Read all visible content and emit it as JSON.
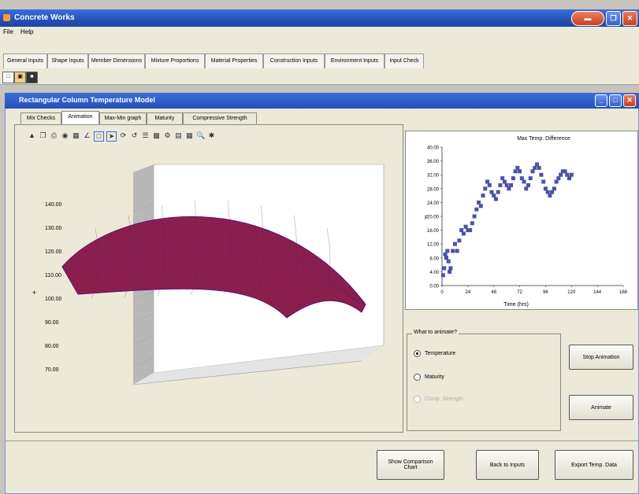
{
  "app": {
    "title": "Concrete Works"
  },
  "menu": {
    "file": "File",
    "help": "Help"
  },
  "top_tabs": [
    "General Inputs",
    "Shape Inputs",
    "Member Dimensions",
    "Mixture Proportions",
    "Material Properties",
    "Construction Inputs",
    "Environment Inputs",
    "Input Check"
  ],
  "inner": {
    "title": "Rectangular Column Temperature Model"
  },
  "sub_tabs": [
    "Mix Checks",
    "Animation",
    "Max-Min graph",
    "Maturity",
    "Compressive Strength"
  ],
  "surface": {
    "z_ticks": [
      "140.00",
      "130.00",
      "120.00",
      "110.00",
      "100.00",
      "90.00",
      "80.00",
      "70.00"
    ],
    "colors": {
      "surface": "#8a1f4e",
      "edge": "#5a1070",
      "wall": "#b8b8b8"
    }
  },
  "chart_data": {
    "type": "scatter",
    "title": "Max Temp. Difference",
    "xlabel": "Time (hrs)",
    "ylabel": "F",
    "xlim": [
      0,
      168
    ],
    "ylim": [
      0,
      40
    ],
    "x_ticks": [
      "0",
      "24",
      "48",
      "72",
      "96",
      "120",
      "144",
      "168"
    ],
    "y_ticks": [
      "40.00",
      "36.00",
      "32.00",
      "28.00",
      "24.00",
      "20.00",
      "16.00",
      "12.00",
      "8.00",
      "4.00",
      "0.00"
    ],
    "series": [
      {
        "color": "#4a52a8",
        "x": [
          1,
          2,
          3,
          4,
          5,
          6,
          7,
          8,
          10,
          12,
          14,
          16,
          18,
          20,
          22,
          24,
          26,
          28,
          30,
          32,
          34,
          36,
          38,
          40,
          42,
          44,
          46,
          48,
          50,
          52,
          54,
          56,
          58,
          60,
          62,
          64,
          66,
          68,
          70,
          72,
          74,
          76,
          78,
          80,
          82,
          84,
          86,
          88,
          90,
          92,
          94,
          96,
          98,
          100,
          102,
          104,
          106,
          108,
          110,
          112,
          114,
          116,
          118,
          120
        ],
        "y": [
          3,
          5,
          9,
          8,
          10,
          7,
          4,
          5,
          10,
          12,
          10,
          13,
          16,
          15,
          17,
          16,
          16,
          18,
          20,
          22,
          24,
          23,
          26,
          28,
          30,
          29,
          27,
          26,
          25,
          27,
          29,
          31,
          30,
          29,
          28,
          29,
          31,
          33,
          34,
          33,
          31,
          30,
          28,
          29,
          31,
          33,
          34,
          35,
          34,
          32,
          30,
          28,
          27,
          26,
          27,
          28,
          30,
          31,
          32,
          33,
          33,
          32,
          31,
          32
        ]
      }
    ]
  },
  "animate_group": {
    "legend": "What to animate?",
    "options": [
      "Temperature",
      "Maturity",
      "Comp. Strength"
    ],
    "selected": "Temperature"
  },
  "buttons": {
    "stop_animation": "Stop Animation",
    "animate": "Animate",
    "show_comparison": "Show Comparison Chart",
    "back_to_inputs": "Back to Inputs",
    "export": "Export Temp. Data"
  }
}
